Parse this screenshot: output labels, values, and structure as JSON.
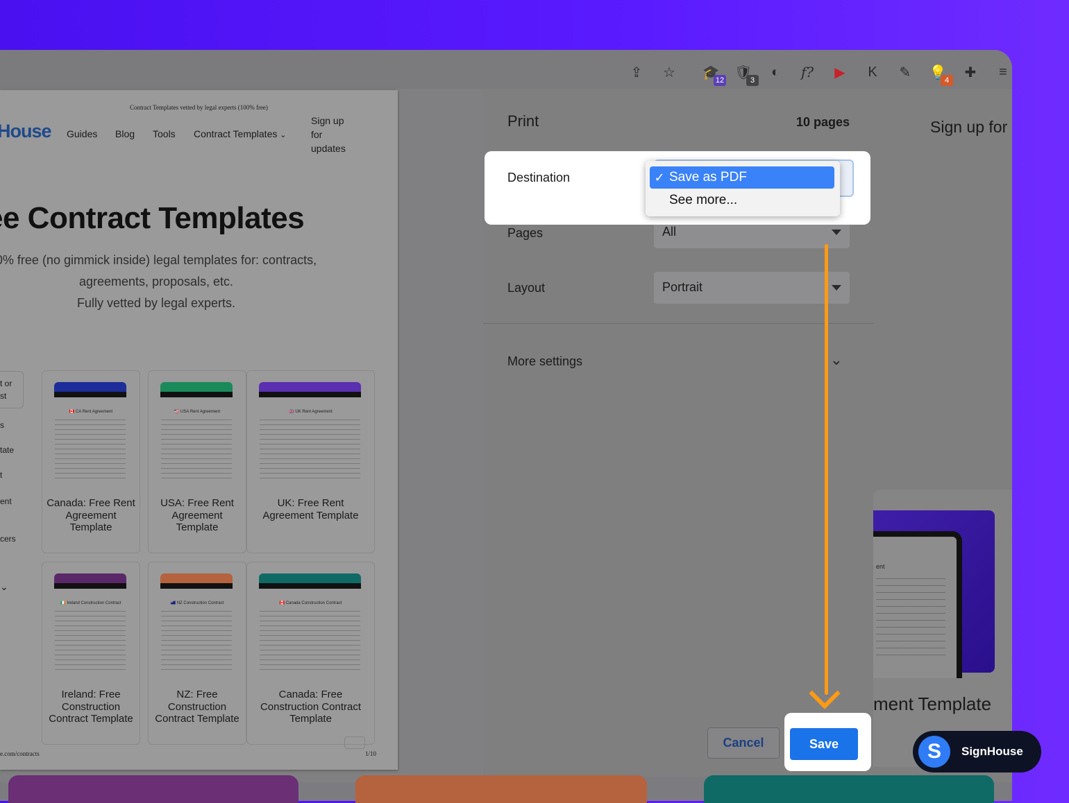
{
  "toolbar": {
    "icons": [
      {
        "name": "share-icon",
        "glyph": "⇪"
      },
      {
        "name": "star-icon",
        "glyph": "☆"
      },
      {
        "name": "extension-graduation-icon",
        "glyph": "🎓",
        "badge": "12",
        "badge_color": "#5b3fb5"
      },
      {
        "name": "extension-ublock-icon",
        "glyph": "🛡",
        "badge": "3",
        "badge_color": "#444444"
      },
      {
        "name": "extension-moon-icon",
        "glyph": "◐"
      },
      {
        "name": "extension-font-icon",
        "glyph": "f?"
      },
      {
        "name": "extension-play-icon",
        "glyph": "▶"
      },
      {
        "name": "extension-k-icon",
        "glyph": "K"
      },
      {
        "name": "eyedropper-icon",
        "glyph": "✎"
      },
      {
        "name": "extension-lightbulb-icon",
        "glyph": "💡",
        "badge": "4",
        "badge_color": "#d35a2a"
      },
      {
        "name": "puzzle-icon",
        "glyph": "✚"
      },
      {
        "name": "playlist-icon",
        "glyph": "≡"
      }
    ]
  },
  "preview": {
    "header": "Contract Templates vetted by legal experts (100% free)",
    "logo": "House",
    "nav": [
      "Guides",
      "Blog",
      "Tools",
      "Contract Templates"
    ],
    "signup": "Sign up for updates",
    "hero_title": "ee Contract Templates",
    "hero_sub_1": "0% free (no gimmick inside) legal templates for: contracts,",
    "hero_sub_2": "agreements, proposals, etc.",
    "hero_sub_3": "Fully vetted by legal experts.",
    "side_items": [
      "t or",
      "st",
      "s",
      "tate",
      "t",
      "ent",
      "cers"
    ],
    "cards": [
      {
        "doc": "🇨🇦 CA Rent Agreement",
        "label": "Canada: Free Rent Agreement Template",
        "color": "#1d2d9a"
      },
      {
        "doc": "🇺🇸 USA Rent Agreement",
        "label": "USA: Free Rent Agreement Template",
        "color": "#1a8a5a"
      },
      {
        "doc": "🇬🇧 UK Rent Agreement",
        "label": "UK: Free Rent Agreement Template",
        "color": "#5a2fb0"
      },
      {
        "doc": "🇮🇪 Ireland Construction Contract",
        "label": "Ireland: Free Construction Contract Template",
        "color": "#5a2868"
      },
      {
        "doc": "🇳🇿 NZ Construction Contract",
        "label": "NZ: Free Construction Contract Template",
        "color": "#b5623e"
      },
      {
        "doc": "🇨🇦 Canada Construction Contract",
        "label": "Canada: Free Construction Contract Template",
        "color": "#0f6a66"
      }
    ],
    "footer_left": "e.com/contracts",
    "footer_right": "1/10"
  },
  "print": {
    "title": "Print",
    "pages_count": "10 pages",
    "destination_label": "Destination",
    "destination_options": [
      "Save as PDF",
      "See more..."
    ],
    "pages_label": "Pages",
    "pages_value": "All",
    "layout_label": "Layout",
    "layout_value": "Portrait",
    "more_settings": "More settings",
    "cancel": "Cancel",
    "save": "Save"
  },
  "right": {
    "signup": "Sign up for",
    "doc_title": "ent",
    "template": "ment Template"
  },
  "brand": {
    "name": "SignHouse",
    "initial": "S"
  },
  "colors": {
    "accent": "#1a73e8",
    "arrow": "#ff9a14",
    "background": "#5a1bff"
  }
}
